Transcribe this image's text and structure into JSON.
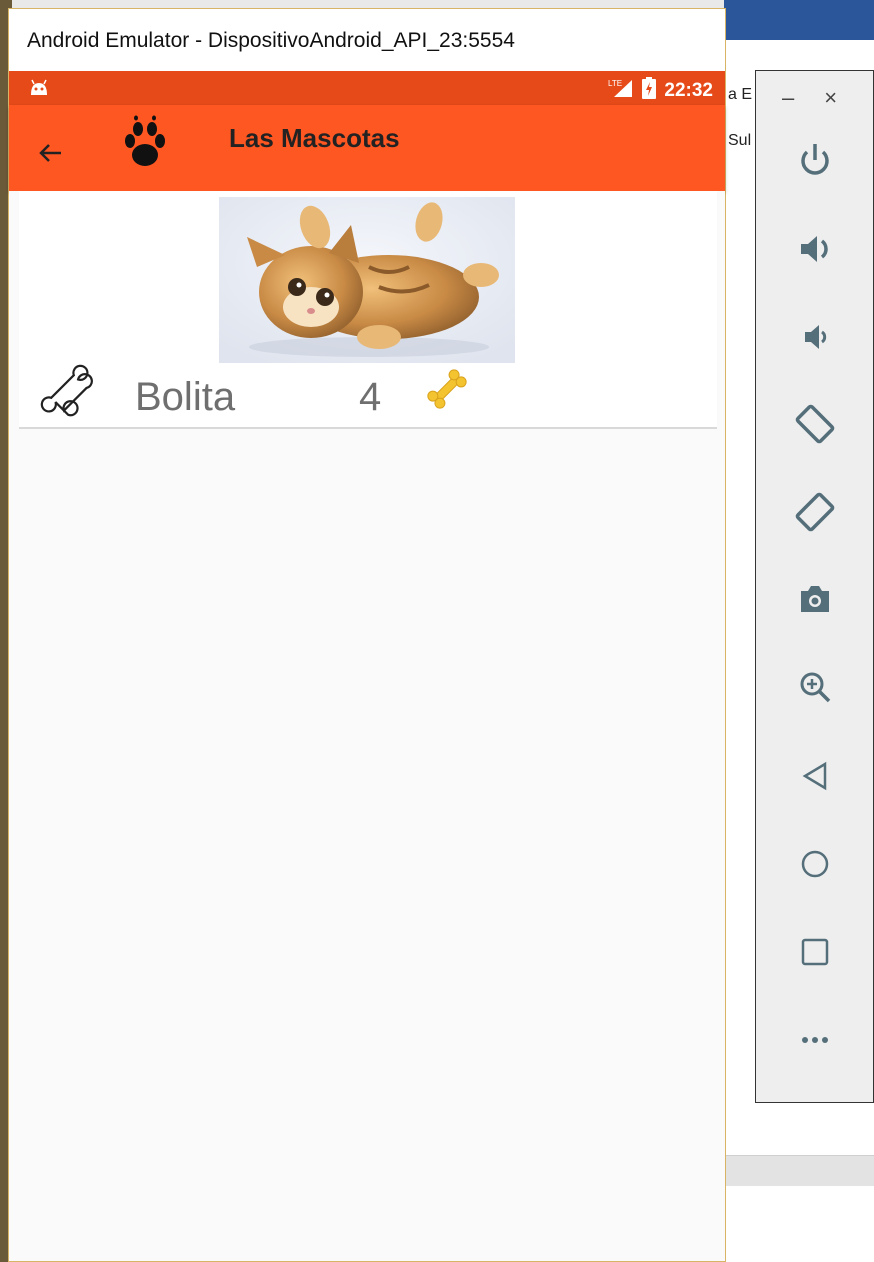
{
  "window": {
    "title": "Android Emulator - DispositivoAndroid_API_23:5554"
  },
  "status_bar": {
    "time": "22:32",
    "network_label": "LTE"
  },
  "toolbar": {
    "title": "Las Mascotas"
  },
  "pets": [
    {
      "name": "Bolita",
      "likes": "4"
    }
  ],
  "background_doc": {
    "fragment_1": "a E",
    "fragment_2": "Sul"
  },
  "side_panel": {
    "minimize": "–",
    "close": "×",
    "buttons": [
      "power",
      "volume-up",
      "volume-down",
      "rotate-left",
      "rotate-right",
      "screenshot",
      "zoom",
      "back",
      "home",
      "overview",
      "more"
    ]
  },
  "colors": {
    "status_bar": "#e64a19",
    "toolbar": "#ff5722",
    "bone_gold": "#f4c430",
    "panel_icon": "#546e7a"
  }
}
